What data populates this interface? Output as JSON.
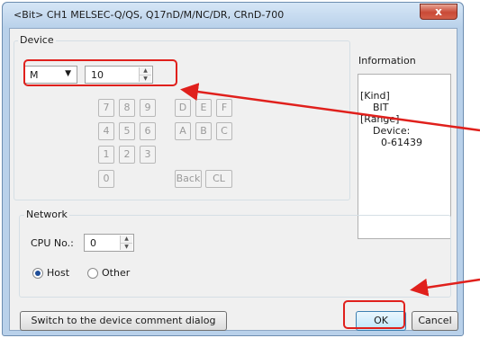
{
  "window": {
    "title": "<Bit> CH1 MELSEC-Q/QS, Q17nD/M/NC/DR, CRnD-700",
    "close_glyph": "x"
  },
  "device": {
    "group_label": "Device",
    "type_value": "M",
    "number_value": "10",
    "keypad": [
      "7",
      "8",
      "9",
      "D",
      "E",
      "F",
      "4",
      "5",
      "6",
      "A",
      "B",
      "C",
      "1",
      "2",
      "3",
      "0",
      "Back",
      "CL"
    ]
  },
  "information": {
    "title": "Information",
    "kind_label": "[Kind]",
    "kind_value": "BIT",
    "range_label": "[Range]",
    "range_device_label": "Device:",
    "range_device_value": "0-61439"
  },
  "network": {
    "group_label": "Network",
    "cpu_label": "CPU No.:",
    "cpu_value": "0",
    "host_label": "Host",
    "other_label": "Other",
    "selected": "Host"
  },
  "buttons": {
    "switch_label": "Switch to the device comment dialog",
    "ok_label": "OK",
    "cancel_label": "Cancel"
  },
  "icons": {
    "dropdown": "chevron-down-icon",
    "spin_up": "spin-up-icon",
    "spin_down": "spin-down-icon"
  },
  "colors": {
    "callout": "#e0201c",
    "title_bar": "#b9d1ea",
    "close_button": "#c94a37"
  }
}
